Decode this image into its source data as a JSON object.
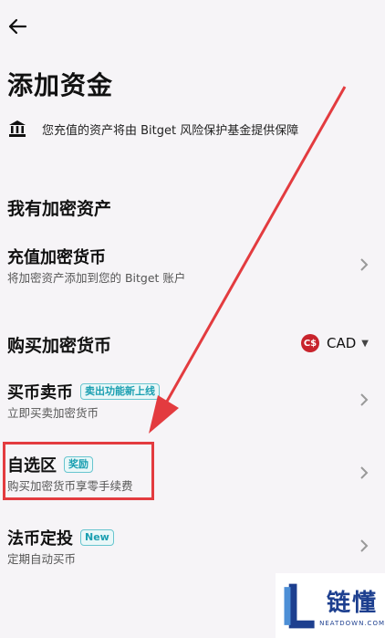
{
  "header": {
    "title": "添加资金"
  },
  "notice": {
    "text": "您充值的资产将由 Bitget 风险保护基金提供保障",
    "icon": "bank-icon"
  },
  "sections": {
    "crypto": {
      "title": "我有加密资产",
      "deposit": {
        "label": "充值加密货币",
        "desc": "将加密资产添加到您的 Bitget 账户"
      }
    },
    "buy": {
      "title": "购买加密货币",
      "currency": {
        "code": "CAD",
        "symbol": "C$"
      },
      "items": [
        {
          "label": "买币卖币",
          "tag": "卖出功能新上线",
          "desc": "立即买卖加密货币"
        },
        {
          "label": "自选区",
          "tag": "奖励",
          "desc": "购买加密货币享零手续费"
        },
        {
          "label": "法币定投",
          "tag": "New",
          "desc": "定期自动买币"
        }
      ]
    }
  },
  "watermark": {
    "main": "链懂",
    "sub": "NEATDOWN.COM"
  },
  "colors": {
    "accent": "#e33b3f",
    "tag": "#1a9fb1",
    "brand": "#1d3f8f"
  }
}
